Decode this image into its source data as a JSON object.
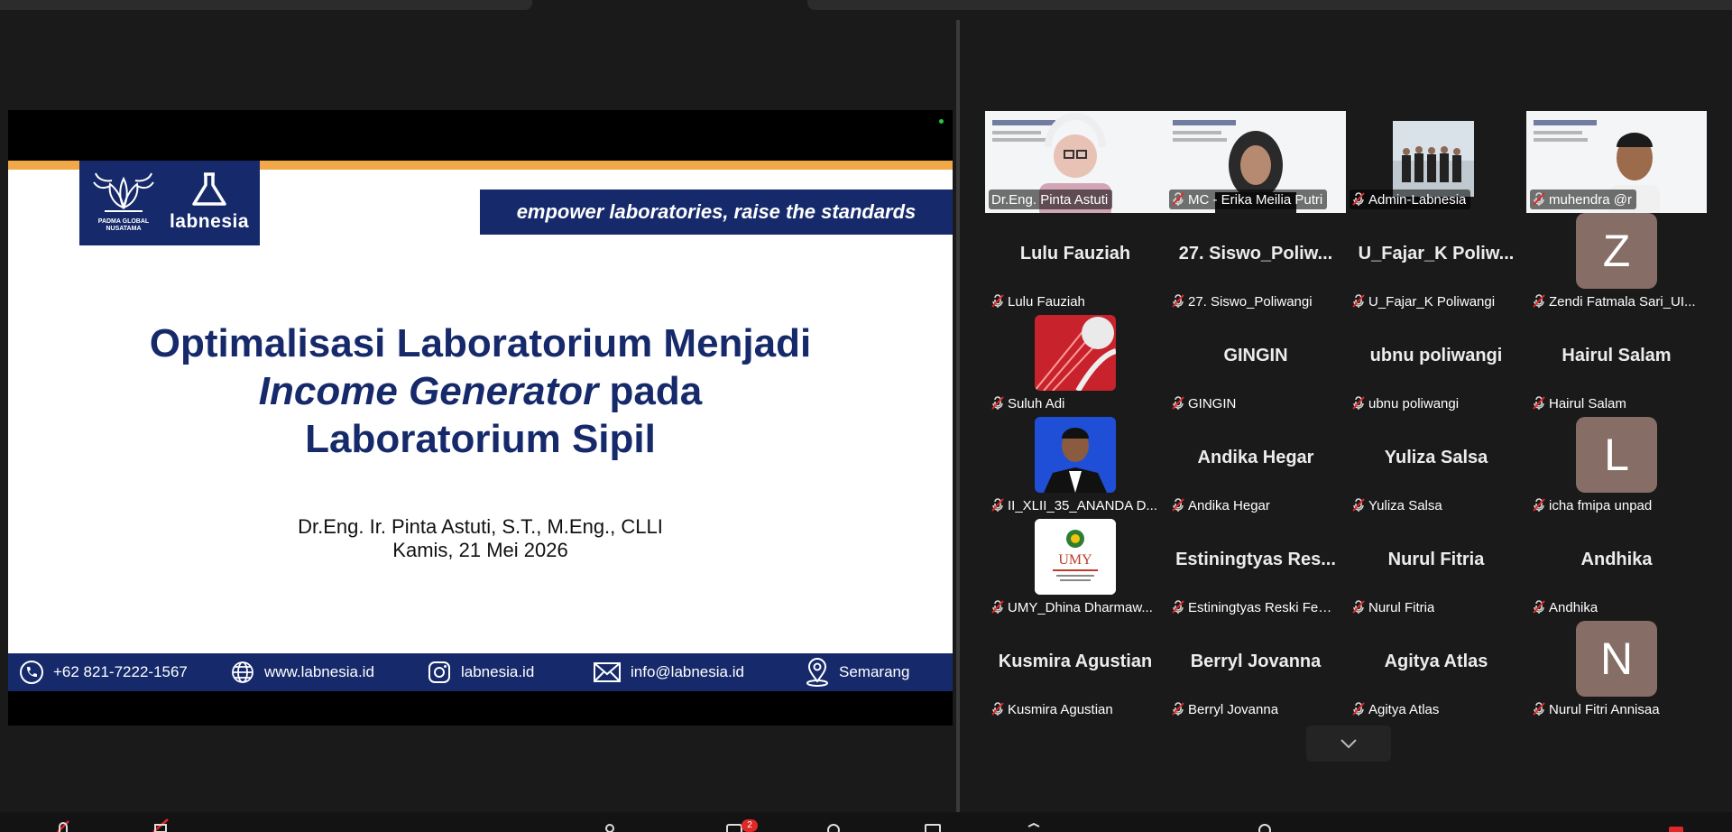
{
  "slide": {
    "brand_padma": "PADMA GLOBAL NUSATAMA",
    "brand_labnesia": "labnesia",
    "tagline": "empower laboratories, raise the standards",
    "title_line1": "Optimalisasi Laboratorium Menjadi",
    "title_line2_italic": "Income Generator",
    "title_line2_rest": " pada",
    "title_line3": "Laboratorium Sipil",
    "presenter": "Dr.Eng. Ir. Pinta Astuti, S.T., M.Eng., CLLI",
    "date": "Kamis, 21 Mei 2026",
    "footer": {
      "phone": "+62 821-7222-1567",
      "website": "www.labnesia.id",
      "instagram": "labnesia.id",
      "email": "info@labnesia.id",
      "location": "Semarang"
    }
  },
  "participants": [
    {
      "name": "Dr.Eng. Pinta Astuti",
      "display": "",
      "kind": "video",
      "active": true
    },
    {
      "name": "MC - Erika Meilia Putri",
      "display": "",
      "kind": "video"
    },
    {
      "name": "Admin-Labnesia",
      "display": "",
      "kind": "video"
    },
    {
      "name": "muhendra @r",
      "display": "",
      "kind": "video"
    },
    {
      "name": "Lulu Fauziah",
      "display": "Lulu Fauziah",
      "kind": "text"
    },
    {
      "name": "27. Siswo_Poliwangi",
      "display": "27.  Siswo_Poliw...",
      "kind": "text"
    },
    {
      "name": "U_Fajar_K Poliwangi",
      "display": "U_Fajar_K  Poliw...",
      "kind": "text"
    },
    {
      "name": "Zendi Fatmala Sari_UI...",
      "display": "Z",
      "kind": "letter"
    },
    {
      "name": "Suluh Adi",
      "display": "",
      "kind": "image"
    },
    {
      "name": "GINGIN",
      "display": "GINGIN",
      "kind": "text"
    },
    {
      "name": "ubnu poliwangi",
      "display": "ubnu poliwangi",
      "kind": "text"
    },
    {
      "name": "Hairul Salam",
      "display": "Hairul Salam",
      "kind": "text"
    },
    {
      "name": "II_XLII_35_ANANDA D...",
      "display": "",
      "kind": "image"
    },
    {
      "name": "Andika Hegar",
      "display": "Andika Hegar",
      "kind": "text"
    },
    {
      "name": "Yuliza Salsa",
      "display": "Yuliza Salsa",
      "kind": "text"
    },
    {
      "name": "icha fmipa unpad",
      "display": "L",
      "kind": "letter"
    },
    {
      "name": "UMY_Dhina Dharmaw...",
      "display": "UMY",
      "kind": "image"
    },
    {
      "name": "Estiningtyas Reski Febr...",
      "display": "Estiningtyas  Res...",
      "kind": "text"
    },
    {
      "name": "Nurul Fitria",
      "display": "Nurul Fitria",
      "kind": "text"
    },
    {
      "name": "Andhika",
      "display": "Andhika",
      "kind": "text"
    },
    {
      "name": "Kusmira Agustian",
      "display": "Kusmira Agustian",
      "kind": "text"
    },
    {
      "name": "Berryl Jovanna",
      "display": "Berryl Jovanna",
      "kind": "text"
    },
    {
      "name": "Agitya Atlas",
      "display": "Agitya Atlas",
      "kind": "text"
    },
    {
      "name": "Nurul Fitri Annisaa",
      "display": "N",
      "kind": "letter"
    }
  ],
  "toolbar": {
    "chat_badge": "2"
  },
  "colors": {
    "slide_navy": "#162a6b",
    "slide_orange": "#f0a848",
    "active_speaker": "#2bd65d",
    "mute_red": "#e02828"
  }
}
